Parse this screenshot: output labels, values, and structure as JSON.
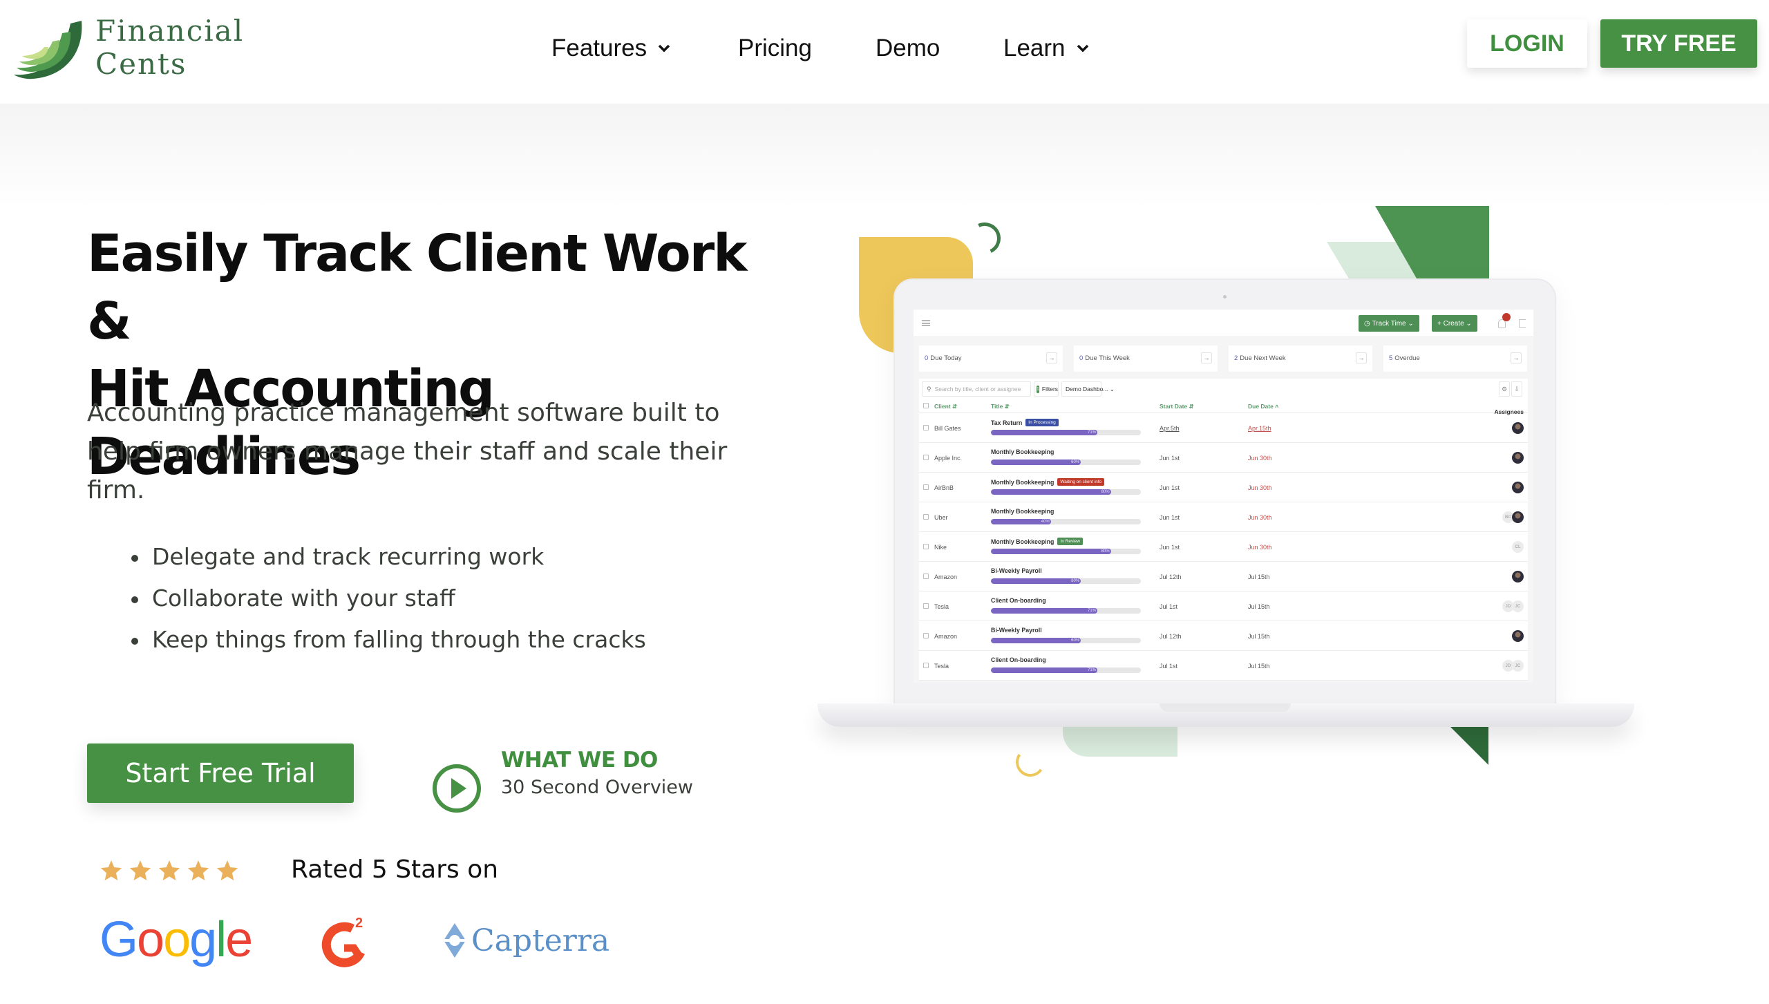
{
  "brand": {
    "name_line1": "Financial",
    "name_line2": "Cents",
    "primary_color": "#469143",
    "accent_yellow": "#edc75a"
  },
  "nav": {
    "items": [
      {
        "label": "Features",
        "has_dropdown": true
      },
      {
        "label": "Pricing",
        "has_dropdown": false
      },
      {
        "label": "Demo",
        "has_dropdown": false
      },
      {
        "label": "Learn",
        "has_dropdown": true
      }
    ],
    "login_label": "LOGIN",
    "try_free_label": "TRY FREE"
  },
  "hero": {
    "headline_line1": "Easily Track Client Work &",
    "headline_line2": "Hit Accounting Deadlines",
    "subtitle": "Accounting practice management software built to help firm owners manage their staff and scale their firm.",
    "bullets": [
      "Delegate and track recurring work",
      "Collaborate with your staff",
      "Keep things from falling through the cracks"
    ],
    "cta_label": "Start Free Trial",
    "video_title": "WHAT WE DO",
    "video_subtitle": "30 Second Overview"
  },
  "ratings": {
    "stars": 5,
    "text": "Rated 5 Stars on",
    "platforms": [
      "Google",
      "G2",
      "Capterra"
    ]
  },
  "app_mockup": {
    "track_time_label": "Track Time",
    "create_label": "Create",
    "stat_cards": [
      {
        "count": "0",
        "label": "Due Today"
      },
      {
        "count": "0",
        "label": "Due This Week"
      },
      {
        "count": "2",
        "label": "Due Next Week"
      },
      {
        "count": "5",
        "label": "Overdue"
      }
    ],
    "search_placeholder": "Search by title, client or assignee",
    "filters_count": "1",
    "filters_label": "Filters",
    "view_select": "Demo Dashbo...",
    "columns": {
      "client": "Client",
      "title": "Title",
      "start_date": "Start Date",
      "due_date": "Due Date",
      "assignees": "Assignees"
    },
    "rows": [
      {
        "client": "Bill Gates",
        "title": "Tax Return",
        "status": "In Processing",
        "status_color": "#3a4fa3",
        "progress": 71,
        "start": "Apr.5th",
        "due": "Apr.15th",
        "due_overdue": true,
        "assignees": [
          {
            "type": "photo"
          }
        ]
      },
      {
        "client": "Apple Inc.",
        "title": "Monthly Bookkeeping",
        "status": "",
        "status_color": "",
        "progress": 60,
        "start": "Jun 1st",
        "due": "Jun 30th",
        "due_overdue": true,
        "assignees": [
          {
            "type": "photo"
          }
        ]
      },
      {
        "client": "AirBnB",
        "title": "Monthly Bookkeeping",
        "status": "Waiting on client info",
        "status_color": "#c0392b",
        "progress": 80,
        "start": "Jun 1st",
        "due": "Jun 30th",
        "due_overdue": true,
        "assignees": [
          {
            "type": "photo"
          }
        ]
      },
      {
        "client": "Uber",
        "title": "Monthly Bookkeeping",
        "status": "",
        "status_color": "",
        "progress": 40,
        "start": "Jun 1st",
        "due": "Jun 30th",
        "due_overdue": true,
        "assignees": [
          {
            "type": "initials",
            "text": "BC"
          },
          {
            "type": "photo"
          }
        ]
      },
      {
        "client": "Nike",
        "title": "Monthly Bookkeeping",
        "status": "In Review",
        "status_color": "#4e8f55",
        "progress": 80,
        "start": "Jun 1st",
        "due": "Jun 30th",
        "due_overdue": true,
        "assignees": [
          {
            "type": "initials",
            "text": "CL"
          }
        ]
      },
      {
        "client": "Amazon",
        "title": "Bi-Weekly Payroll",
        "status": "",
        "status_color": "",
        "progress": 60,
        "start": "Jul 12th",
        "due": "Jul 15th",
        "due_overdue": false,
        "assignees": [
          {
            "type": "photo"
          }
        ]
      },
      {
        "client": "Tesla",
        "title": "Client On-boarding",
        "status": "",
        "status_color": "",
        "progress": 71,
        "start": "Jul 1st",
        "due": "Jul 15th",
        "due_overdue": false,
        "assignees": [
          {
            "type": "initials",
            "text": "JD"
          },
          {
            "type": "initials",
            "text": "JC"
          }
        ]
      },
      {
        "client": "Amazon",
        "title": "Bi-Weekly Payroll",
        "status": "",
        "status_color": "",
        "progress": 60,
        "start": "Jul 12th",
        "due": "Jul 15th",
        "due_overdue": false,
        "assignees": [
          {
            "type": "photo"
          }
        ]
      },
      {
        "client": "Tesla",
        "title": "Client On-boarding",
        "status": "",
        "status_color": "",
        "progress": 71,
        "start": "Jul 1st",
        "due": "Jul 15th",
        "due_overdue": false,
        "assignees": [
          {
            "type": "initials",
            "text": "JD"
          },
          {
            "type": "initials",
            "text": "JC"
          }
        ]
      }
    ]
  }
}
